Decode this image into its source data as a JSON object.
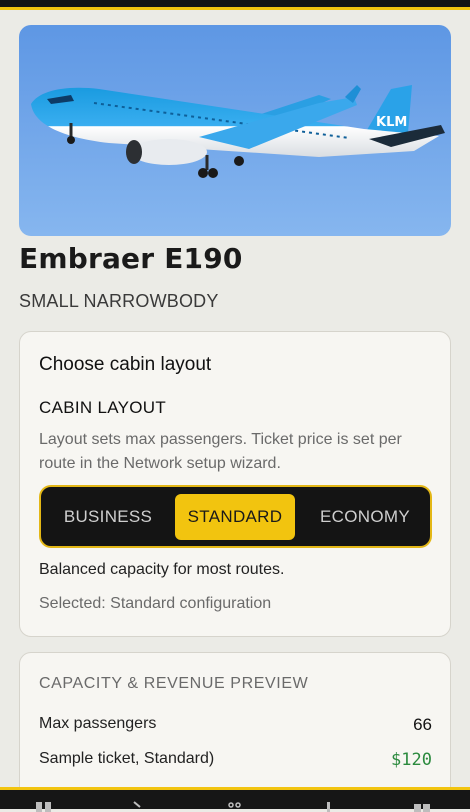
{
  "aircraft": {
    "name": "Embraer E190",
    "class": "SMALL NARROWBODY",
    "livery_text": "KLM"
  },
  "cabin_card": {
    "heading": "Choose cabin layout",
    "section_label": "CABIN LAYOUT",
    "description": "Layout sets max passengers. Ticket price is set per route in the Network setup wizard.",
    "options": [
      "BUSINESS",
      "STANDARD",
      "ECONOMY"
    ],
    "selected_option": "STANDARD",
    "option_note": "Balanced capacity for most routes.",
    "selected_text": "Selected: Standard configuration"
  },
  "preview_card": {
    "label": "CAPACITY & REVENUE PREVIEW",
    "rows": [
      {
        "key": "Max passengers",
        "value": "66"
      },
      {
        "key": "Sample ticket, Standard)",
        "value": "$120"
      }
    ]
  },
  "colors": {
    "accent": "#f2c40f",
    "dark": "#141414",
    "money": "#2b8a3e",
    "sky": "#6fa3e6"
  },
  "bottom_nav": [
    "routes-icon",
    "arrow-icon",
    "network-icon",
    "stats-icon",
    "grid-icon"
  ]
}
